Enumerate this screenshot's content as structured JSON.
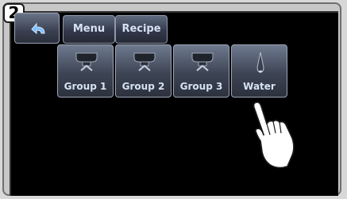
{
  "step_number": "2",
  "nav": {
    "back_icon": "back-arrow-icon",
    "menu_label": "Menu",
    "recipe_label": "Recipe"
  },
  "groups": [
    {
      "label": "Group 1",
      "icon": "coffee-group-icon"
    },
    {
      "label": "Group 2",
      "icon": "coffee-group-icon"
    },
    {
      "label": "Group 3",
      "icon": "coffee-group-icon"
    },
    {
      "label": "Water",
      "icon": "water-nozzle-icon"
    }
  ],
  "overlay": {
    "icon": "pointing-hand-icon"
  },
  "colors": {
    "screen": "#000000",
    "button_text": "#d6e2f2",
    "bezel": "#c7c7c7"
  }
}
